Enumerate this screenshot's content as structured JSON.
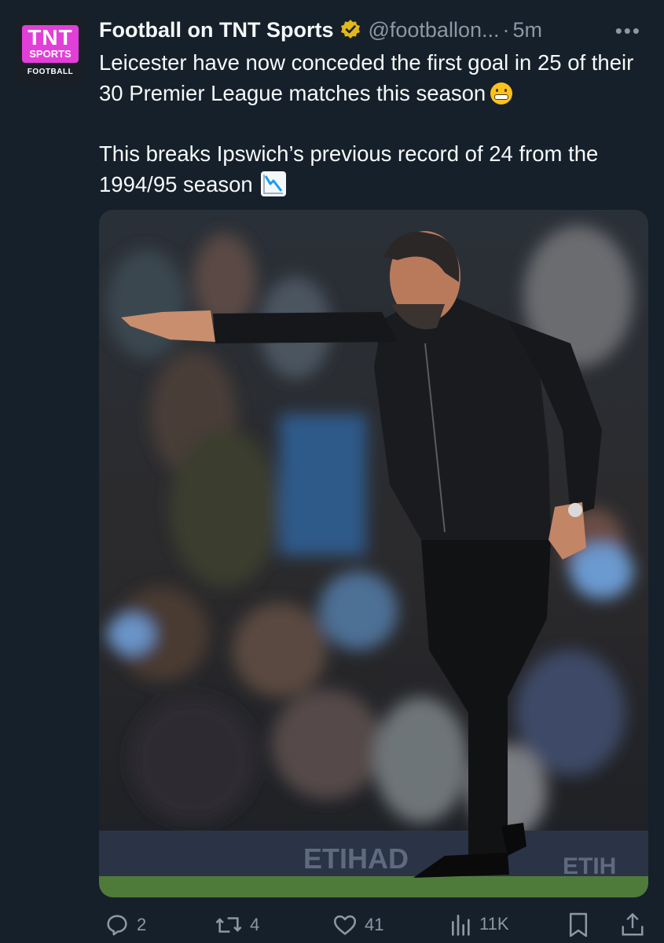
{
  "tweet": {
    "display_name": "Football on TNT Sports",
    "handle": "@footballon...",
    "separator": "·",
    "time": "5m",
    "more": "•••",
    "line1": "Leicester have now conceded the first goal in 25 of their 30 Premier League matches this season",
    "line2": "This breaks Ipswich’s previous record of 24 from the 1994/95 season",
    "emoji1": "grimacing-face",
    "emoji2": "chart-decreasing"
  },
  "avatar": {
    "logo_tnt": "TNT",
    "logo_sports": "SPORTS",
    "logo_football": "FOOTBALL",
    "brand_color": "#e23fd8"
  },
  "photo": {
    "alt": "Manager in black gesturing on touchline in front of crowd",
    "board_text_1": "ETIHAD",
    "board_text_2": "ETIH"
  },
  "actions": {
    "replies": "2",
    "reposts": "4",
    "likes": "41",
    "views": "11K"
  },
  "colors": {
    "background": "#15202b",
    "text": "#f7f9f9",
    "secondary": "#8b98a5",
    "verified_gold": "#e2b719"
  }
}
